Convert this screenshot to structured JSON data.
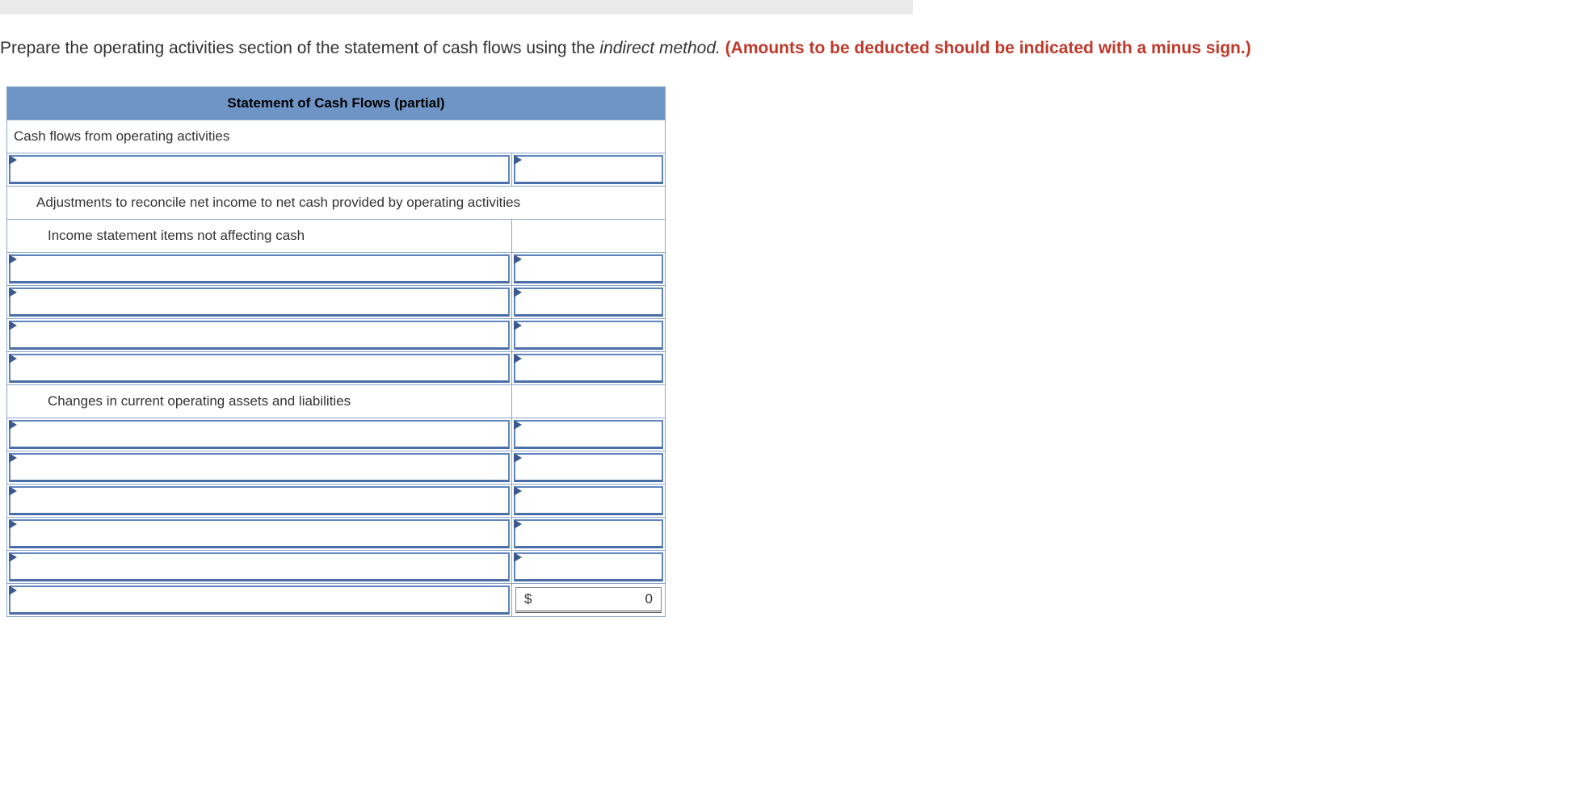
{
  "instruction": {
    "part1": "Prepare the operating activities section of the statement of cash flows using the ",
    "italic": "indirect method.",
    "red_bold": " (Amounts to be deducted should be indicated with a minus sign.)"
  },
  "table": {
    "header": "Statement of Cash Flows (partial)",
    "row_operating": "Cash flows from operating activities",
    "row_adjustments": "Adjustments to reconcile net income to net cash provided by operating activities",
    "row_income_items": "Income statement items not affecting cash",
    "row_changes": "Changes in current operating assets and liabilities",
    "total_currency": "$",
    "total_value": "0"
  }
}
